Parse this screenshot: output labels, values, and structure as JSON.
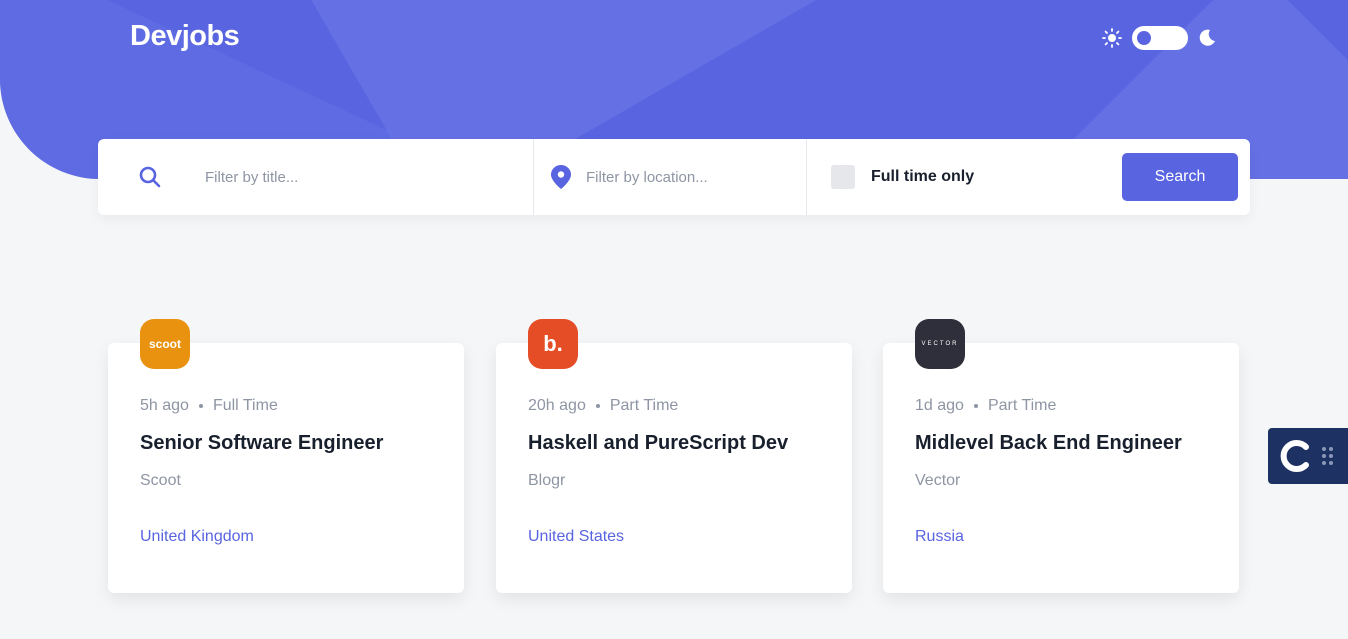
{
  "header": {
    "logo": "Devjobs",
    "accent_color": "#5964e0",
    "theme_icons": [
      "sun-icon",
      "moon-icon"
    ]
  },
  "search": {
    "title_placeholder": "Filter by title...",
    "location_placeholder": "Filter by location...",
    "fulltime_label": "Full time only",
    "button_label": "Search"
  },
  "jobs": [
    {
      "logo_text": "scoot",
      "logo_color": "#e99210",
      "posted": "5h ago",
      "contract": "Full Time",
      "title": "Senior Software Engineer",
      "company": "Scoot",
      "location": "United Kingdom"
    },
    {
      "logo_text": "b.",
      "logo_color": "#e54d26",
      "posted": "20h ago",
      "contract": "Part Time",
      "title": "Haskell and PureScript Dev",
      "company": "Blogr",
      "location": "United States"
    },
    {
      "logo_text": "vector",
      "logo_color": "#2e2f3a",
      "posted": "1d ago",
      "contract": "Part Time",
      "title": "Midlevel Back End Engineer",
      "company": "Vector",
      "location": "Russia"
    }
  ],
  "widget": {
    "icon": "app-logo-icon"
  }
}
